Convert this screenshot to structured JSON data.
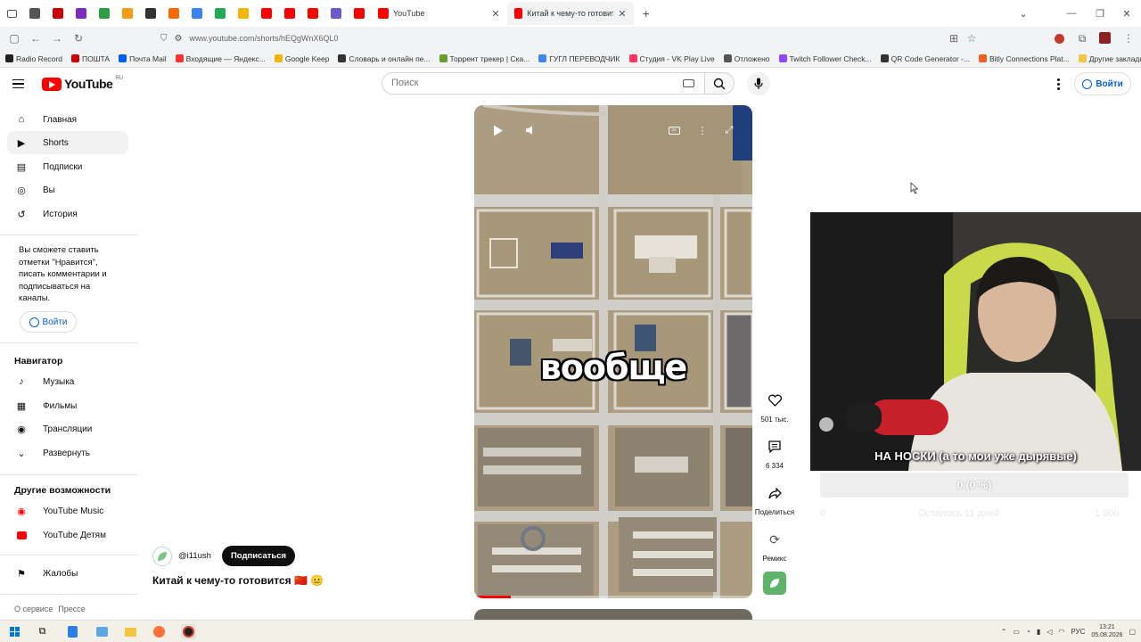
{
  "browser": {
    "tabs": [
      {
        "label": "YouTube",
        "favicon_color": "#ff0000"
      },
      {
        "label": "Китай к чему-то готовится 🇨🇳",
        "favicon_color": "#ff0000"
      }
    ],
    "pinned_tab_colors": [
      "#555555",
      "#cc0000",
      "#7b2cbf",
      "#2e9e44",
      "#f39c12",
      "#333333",
      "#ff6a00",
      "#3b82f6",
      "#22aa55",
      "#f4b400",
      "#ff0000",
      "#ff0000",
      "#ff0000",
      "#6a5acd",
      "#ff0000"
    ],
    "url": "www.youtube.com/shorts/hEQgWnX6QL0",
    "bookmarks": [
      {
        "label": "Radio Record",
        "color": "#222222"
      },
      {
        "label": "ПОШТА",
        "color": "#cc0000"
      },
      {
        "label": "Почта Mail",
        "color": "#005ff9"
      },
      {
        "label": "Входящие — Яндекс...",
        "color": "#ff3333"
      },
      {
        "label": "Google Keep",
        "color": "#f4b400"
      },
      {
        "label": "Словарь и онлайн пе...",
        "color": "#333333"
      },
      {
        "label": "Торрент трекер | Ска...",
        "color": "#6a9e2a"
      },
      {
        "label": "ГУГЛ ПЕРЕВОДЧИК",
        "color": "#4285f4"
      },
      {
        "label": "Студия - VK Play Live",
        "color": "#ff3366"
      },
      {
        "label": "Отложено",
        "color": "#555555"
      },
      {
        "label": "Twitch Follower Check...",
        "color": "#9146ff"
      },
      {
        "label": "QR Code Generator -...",
        "color": "#333333"
      },
      {
        "label": "Bitly Connections Plat...",
        "color": "#ee6123"
      }
    ],
    "other_bookmarks": "Другие закладки"
  },
  "youtube": {
    "logo_text": "YouTube",
    "logo_country": "RU",
    "search_placeholder": "Поиск",
    "signin": "Войти"
  },
  "sidebar": {
    "main": [
      {
        "label": "Главная",
        "icon": "home-icon"
      },
      {
        "label": "Shorts",
        "icon": "shorts-icon"
      },
      {
        "label": "Подписки",
        "icon": "subscriptions-icon"
      },
      {
        "label": "Вы",
        "icon": "you-icon"
      },
      {
        "label": "История",
        "icon": "history-icon"
      }
    ],
    "note": "Вы сможете ставить отметки \"Нравится\", писать комментарии и подписываться на каналы.",
    "signin": "Войти",
    "navigator_heading": "Навигатор",
    "navigator": [
      {
        "label": "Музыка",
        "icon": "music-icon"
      },
      {
        "label": "Фильмы",
        "icon": "film-icon"
      },
      {
        "label": "Трансляции",
        "icon": "live-icon"
      },
      {
        "label": "Развернуть",
        "icon": "chevron-down-icon"
      }
    ],
    "other_heading": "Другие возможности",
    "other": [
      {
        "label": "YouTube Music",
        "icon": "youtube-music-icon"
      },
      {
        "label": "YouTube Детям",
        "icon": "youtube-kids-icon"
      }
    ],
    "report": {
      "label": "Жалобы",
      "icon": "flag-icon"
    },
    "footer": [
      "О сервисе",
      "Прессе"
    ]
  },
  "video": {
    "caption": "вообще",
    "progress_fraction": 0.13,
    "channel": "@i11ush",
    "subscribe": "Подписаться",
    "title": "Китай к чему-то готовится 🇨🇳 😐",
    "likes": "501 тыс.",
    "comments": "6 334",
    "share": "Поделиться",
    "remix": "Ремикс"
  },
  "stream_overlay": {
    "caption": "НА НОСКИ (а то мои уже дырявые)",
    "goal_percent_label": "0 (0 %)",
    "goal_fraction": 0.0,
    "goal_min": "0",
    "goal_remaining": "Осталось 11 дней",
    "goal_max": "1 000"
  },
  "taskbar": {
    "language": "РУС",
    "time": "13:21",
    "date": "05.08.2026"
  }
}
